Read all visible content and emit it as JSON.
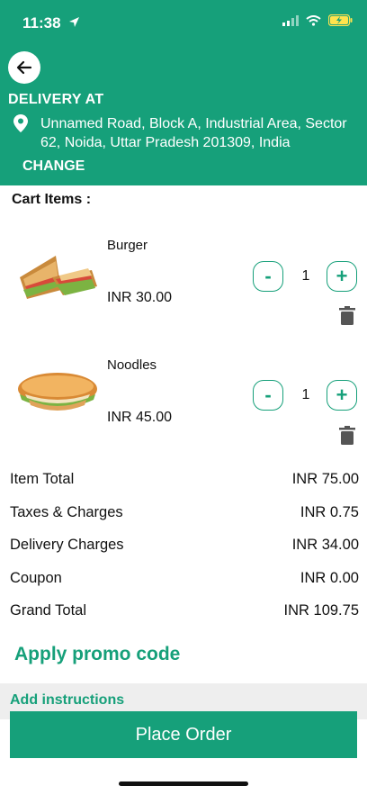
{
  "status": {
    "time": "11:38"
  },
  "delivery": {
    "title": "DELIVERY AT",
    "address": "Unnamed Road, Block A, Industrial Area, Sector 62, Noida, Uttar Pradesh 201309, India",
    "change_label": "CHANGE"
  },
  "cart": {
    "title": "Cart Items :",
    "items": [
      {
        "name": "Burger",
        "price": "INR 30.00",
        "qty": "1",
        "minus": "-",
        "plus": "+"
      },
      {
        "name": "Noodles",
        "price": "INR 45.00",
        "qty": "1",
        "minus": "-",
        "plus": "+"
      }
    ]
  },
  "summary": [
    {
      "label": "Item Total",
      "value": "INR 75.00"
    },
    {
      "label": "Taxes & Charges",
      "value": "INR 0.75"
    },
    {
      "label": "Delivery Charges",
      "value": "INR 34.00"
    },
    {
      "label": "Coupon",
      "value": "INR 0.00"
    },
    {
      "label": "Grand Total",
      "value": "INR 109.75"
    }
  ],
  "promo_label": "Apply promo code",
  "instructions_label": "Add instructions",
  "place_order_label": "Place Order",
  "colors": {
    "primary": "#16a07a",
    "background": "#ffffff"
  }
}
